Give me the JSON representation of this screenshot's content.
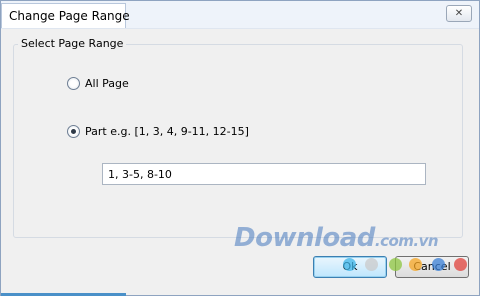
{
  "window": {
    "title": "Change Page Range",
    "close_icon": "close-icon"
  },
  "group": {
    "label": "Select Page Range"
  },
  "options": {
    "all_page": {
      "label": "All Page",
      "checked": false
    },
    "part": {
      "label": "Part e.g. [1, 3, 4, 9-11, 12-15]",
      "checked": true
    }
  },
  "range_input": {
    "value": "1, 3-5, 8-10"
  },
  "buttons": {
    "ok_label": "Ok",
    "cancel_label": "Cancel"
  },
  "watermark": {
    "brand": "Download",
    "domain": ".com.vn",
    "colors": [
      "#3fb5e8",
      "#c9c9c9",
      "#8cc63f",
      "#f5a623",
      "#3a7fd5",
      "#e0413b"
    ]
  }
}
